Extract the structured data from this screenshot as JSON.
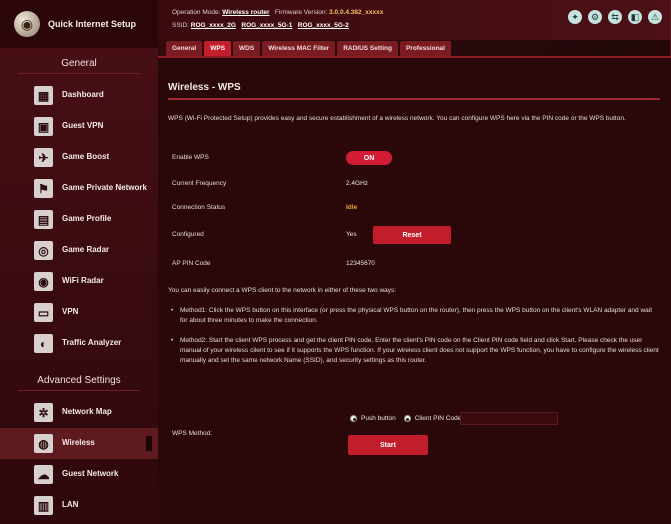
{
  "brand": {
    "label": "Quick Internet Setup"
  },
  "sidebar": {
    "general_heading": "General",
    "advanced_heading": "Advanced Settings",
    "general_items": [
      {
        "label": "Dashboard",
        "icon": "dashboard-icon"
      },
      {
        "label": "Guest VPN",
        "icon": "guest-vpn-icon"
      },
      {
        "label": "Game Boost",
        "icon": "game-boost-icon"
      },
      {
        "label": "Game Private Network",
        "icon": "game-private-network-icon"
      },
      {
        "label": "Game Profile",
        "icon": "game-profile-icon"
      },
      {
        "label": "Game Radar",
        "icon": "game-radar-icon"
      },
      {
        "label": "WiFi Radar",
        "icon": "wifi-radar-icon"
      },
      {
        "label": "VPN",
        "icon": "vpn-icon"
      },
      {
        "label": "Traffic Analyzer",
        "icon": "traffic-analyzer-icon"
      }
    ],
    "advanced_items": [
      {
        "label": "Network Map",
        "icon": "network-map-icon"
      },
      {
        "label": "Wireless",
        "icon": "wireless-icon",
        "active": true
      },
      {
        "label": "Guest Network",
        "icon": "guest-network-icon"
      },
      {
        "label": "LAN",
        "icon": "lan-icon"
      }
    ]
  },
  "header": {
    "operation_mode_label": "Operation Mode:",
    "operation_mode_value": "Wireless router",
    "firmware_label": "Firmware Version:",
    "firmware_value": "3.0.0.4.382_xxxxx",
    "ssid_label": "SSID:",
    "ssid_values": [
      "ROG_xxxx_2G",
      "ROG_xxxx_5G-1",
      "ROG_xxxx_5G-2"
    ]
  },
  "tabs": [
    "General",
    "WPS",
    "WDS",
    "Wireless MAC Filter",
    "RADIUS Setting",
    "Professional"
  ],
  "active_tab": "WPS",
  "page": {
    "title": "Wireless - WPS",
    "description": "WPS (Wi-Fi Protected Setup) provides easy and secure establishment of a wireless network. You can configure WPS here via the PIN code or the WPS button.",
    "enable_wps_label": "Enable WPS",
    "enable_wps_value": "ON",
    "current_frequency_label": "Current Frequency",
    "current_frequency_value": "2.4GHz",
    "connection_status_label": "Connection Status",
    "connection_status_value": "Idle",
    "configured_label": "Configured",
    "configured_value": "Yes",
    "reset_label": "Reset",
    "ap_pin_label": "AP PIN Code",
    "ap_pin_value": "12345670",
    "intro_paragraph": "You can easily connect a WPS client to the network in either of these two ways:",
    "method1": "Method1: Click the WPS button on this interface (or press the physical WPS button on the router), then press the WPS button on the client's WLAN adapter and wait for about three minutes to make the connection.",
    "method2": "Method2: Start the client WPS process and get the client PIN code. Enter the client's PIN code on the Client PIN code field and click Start. Please check the user manual of your wireless client to see if it supports the WPS function. If your wireless client does not support the WPS function, you have to configure the wireless client manually and set the same network Name (SSID), and security settings as this router.",
    "wps_method_label": "WPS Method:",
    "push_button_label": "Push button",
    "client_pin_label": "Client PIN Code:",
    "client_pin_value": "",
    "start_label": "Start"
  }
}
